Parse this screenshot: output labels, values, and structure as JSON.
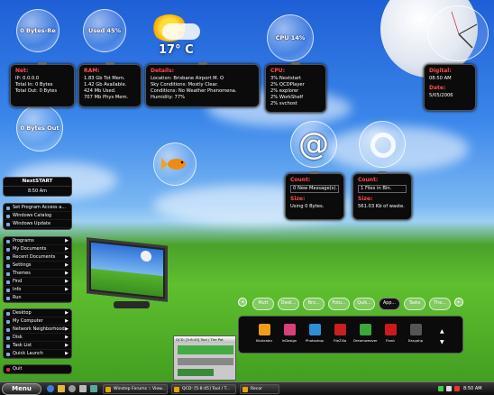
{
  "bubbles": {
    "recycle": "0 Bytes-Re",
    "hdd": "Used 45%",
    "cpu": "CPU 14%",
    "network": "0 Bytes Out",
    "temp": "17° C"
  },
  "net_panel": {
    "title": "Net:",
    "lines": [
      "IP: 0.0.0.0",
      "Total In: 0 Bytes",
      "Total Out: 0 Bytes"
    ]
  },
  "ram_panel": {
    "title": "RAM:",
    "lines": [
      "1.83 Gb Tot Mem.",
      "1.42 Gb Available.",
      "424 Mb Used.",
      "707 Mb Phys Mem."
    ]
  },
  "details_panel": {
    "title": "Details:",
    "lines": [
      "Location: Brisbane Airport M. O",
      "Sky Conditions: Mostly Clear.",
      "Conditions: No Weather Phenomena.",
      "Humidity: 77%"
    ]
  },
  "cpu_panel": {
    "title": "CPU:",
    "lines": [
      "3% Nextstart",
      "2% QCDPlayer",
      "2% explorer",
      "2% WorkShelf",
      "2% svchost"
    ]
  },
  "digital_panel": {
    "title": "Digital:",
    "time": "08:50 AM",
    "date_title": "Date:",
    "date": "5/05/2006"
  },
  "mail_bubble": "@",
  "count_mail": {
    "title": "Count:",
    "value": "0 New Message(s).",
    "size_title": "Size:",
    "size": "Using 0 Bytes."
  },
  "count_bin": {
    "title": "Count:",
    "value": "1 Files in Bin.",
    "size_title": "Size:",
    "size": "561.03 Kb of waste."
  },
  "nextstart": {
    "title": "NextSTART",
    "time": "8:50 Am",
    "top_items": [
      "Set Program Access a...",
      "Windows Catalog",
      "Windows Update"
    ],
    "mid_items": [
      "Programs",
      "My Documents",
      "Recent Documents",
      "Settings",
      "Themes",
      "Find",
      "Info",
      "Run"
    ],
    "lower_items": [
      "Desktop",
      "My Computer",
      "Network Neighborhood",
      "Disk",
      "Task List",
      "Quick Launch"
    ],
    "quit": "Quit"
  },
  "dock_tabs": [
    "Mutt",
    "Desk...",
    "Bro...",
    "Foto...",
    "Quik...",
    "App...",
    "Tasks",
    "The..."
  ],
  "dock_apps": [
    {
      "label": "Illustrator",
      "color": "#f29a1a"
    },
    {
      "label": "InDesign",
      "color": "#d8407a"
    },
    {
      "label": "Photoshop",
      "color": "#2f8fd6"
    },
    {
      "label": "FileZilla",
      "color": "#c82020"
    },
    {
      "label": "Dreamweaver",
      "color": "#3aa83a"
    },
    {
      "label": "Flash",
      "color": "#cc1a1a"
    },
    {
      "label": "Easyphp",
      "color": "#555555"
    }
  ],
  "qcd_window": "QCD: [5:8:45] Tool / The Pot",
  "taskbar": {
    "menu": "Menu",
    "buttons": [
      "Winstep Forums :: View...",
      "QCD: [5:8:45] Tool / T...",
      "Recor"
    ],
    "clock": "8:50 AM"
  }
}
